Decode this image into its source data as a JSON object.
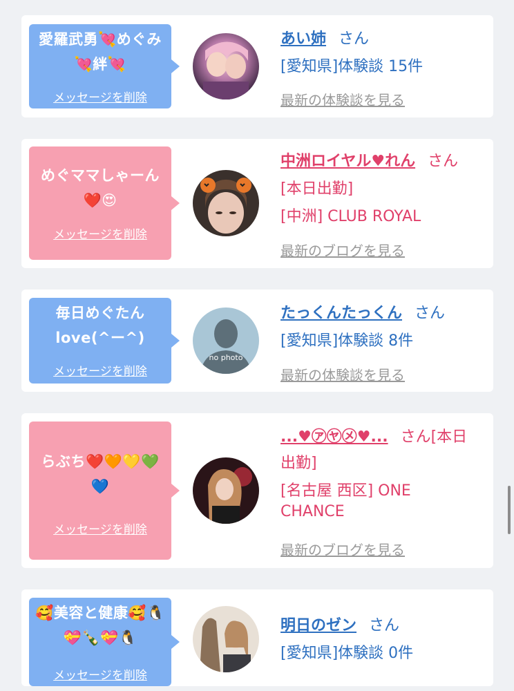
{
  "cards": [
    {
      "bubble_message": "愛羅武勇💘めぐみ💘絆💘",
      "delete_label": "メッセージを削除",
      "name": "あい姉",
      "honorific": "さん",
      "details": [
        "[愛知県]体験談 15件"
      ],
      "more_link": "最新の体験談を見る"
    },
    {
      "bubble_message": "めぐママしゃーん❤️😍",
      "delete_label": "メッセージを削除",
      "name": "中洲ロイヤル♥れん",
      "honorific": "さん",
      "details": [
        "[本日出勤]",
        "[中洲] CLUB ROYAL"
      ],
      "more_link": "最新のブログを見る"
    },
    {
      "bubble_message": "毎日めぐたんlove(^ー^)",
      "delete_label": "メッセージを削除",
      "name": "たっくんたっくん",
      "honorific": "さん",
      "avatar_caption": "no photo",
      "details": [
        "[愛知県]体験談 8件"
      ],
      "more_link": "最新の体験談を見る"
    },
    {
      "bubble_message": "らぶち❤️🧡💛💚💙",
      "delete_label": "メッセージを削除",
      "name": "...♥㋐㋳㋱♥...",
      "honorific": "さん[本日",
      "honorific_cont": "出勤]",
      "details": [
        "[名古屋 西区] ONE",
        "CHANCE"
      ],
      "more_link": "最新のブログを見る"
    },
    {
      "bubble_message": "🥰美容と健康🥰🐧💝🍾💝🐧",
      "delete_label": "メッセージを削除",
      "name": "明日のゼン",
      "honorific": "さん",
      "details": [
        "[愛知県]体験談 0件"
      ],
      "more_link": ""
    }
  ],
  "colors": {
    "bubble_blue": "#7fb0f2",
    "bubble_pink": "#f7a0b1",
    "name_blue": "#2e70c0",
    "name_pink": "#e0406a",
    "link_gray": "#9a9a9a",
    "background": "#eff1f4"
  }
}
